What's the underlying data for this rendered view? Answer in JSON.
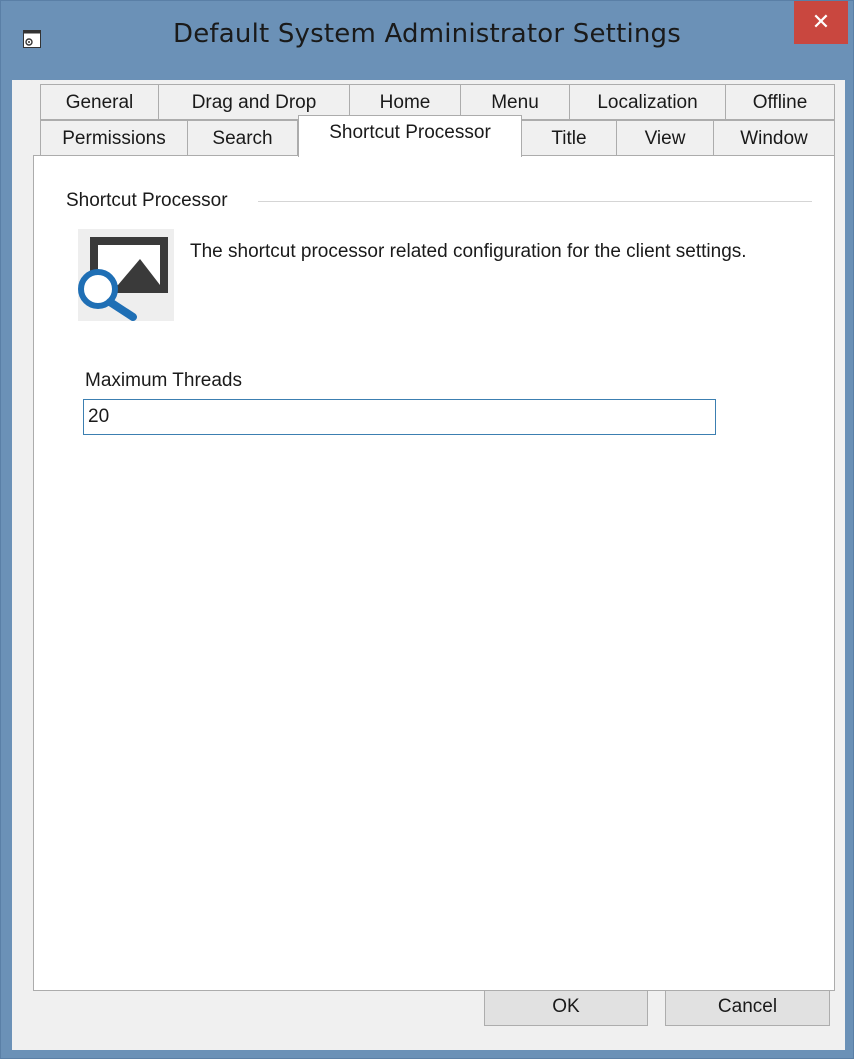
{
  "window": {
    "title": "Default System Administrator Settings",
    "close_glyph": "✕"
  },
  "tabs": {
    "row1": [
      "General",
      "Drag and Drop",
      "Home",
      "Menu",
      "Localization",
      "Offline"
    ],
    "row2": [
      "Permissions",
      "Search",
      "Shortcut Processor",
      "Title",
      "View",
      "Window"
    ],
    "active": "Shortcut Processor"
  },
  "panel": {
    "group_title": "Shortcut Processor",
    "description": "The shortcut processor related configuration for the client settings.",
    "icon": "image-search-icon",
    "max_threads_label": "Maximum Threads",
    "max_threads_value": "20"
  },
  "buttons": {
    "ok_label": "OK",
    "cancel_label": "Cancel"
  },
  "colors": {
    "window_frame": "#6b91b7",
    "close_button": "#c9473f",
    "input_border": "#3c7fb1",
    "icon_blue": "#1f6fb5"
  }
}
